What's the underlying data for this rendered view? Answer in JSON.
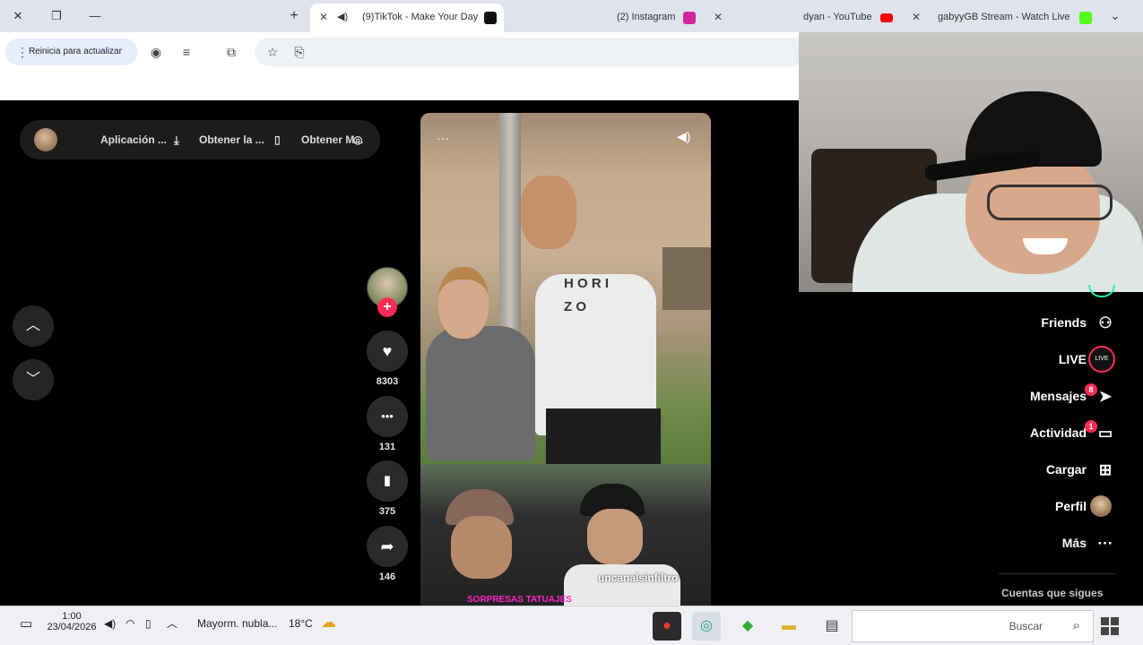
{
  "browser": {
    "tabs": [
      {
        "title": "gabyyGB Stream - Watch Live",
        "favicon": "kick-icon",
        "color": "#53fc18"
      },
      {
        "title": "dyan - YouTube",
        "favicon": "youtube-icon",
        "color": "#ff0000"
      },
      {
        "title": "(2) Instagram",
        "favicon": "instagram-icon",
        "color": "#d6249f"
      },
      {
        "title": "(9)TikTok - Make Your Day",
        "favicon": "tiktok-icon",
        "color": "#111111",
        "active": true
      }
    ],
    "new_tab": "+",
    "update_label": "Reinicia para actualizar"
  },
  "tiktok": {
    "top_bar_items": [
      "Obtener M...",
      "Obtener la ...",
      "Aplicación ..."
    ],
    "actions": [
      {
        "icon": "heart-icon",
        "glyph": "♥",
        "count": "8303"
      },
      {
        "icon": "comment-icon",
        "glyph": "•••",
        "count": "131"
      },
      {
        "icon": "bookmark-icon",
        "glyph": "▮",
        "count": "375"
      },
      {
        "icon": "share-icon",
        "glyph": "➦",
        "count": "146"
      }
    ],
    "follow": "+",
    "shirt_letters": "H O R I Z O",
    "caption": "uncanalsinfiltro",
    "caption_small": "SORPRESAS TATUAJES",
    "nav": [
      {
        "label": "Friends",
        "icon": "friends-icon",
        "glyph": "👥"
      },
      {
        "label": "LIVE",
        "icon": "live-icon",
        "glyph": "LIVE"
      },
      {
        "label": "Mensajes",
        "icon": "messages-icon",
        "glyph": "➤",
        "badge": "8"
      },
      {
        "label": "Actividad",
        "icon": "activity-icon",
        "glyph": "▭",
        "badge": "1"
      },
      {
        "label": "Cargar",
        "icon": "upload-icon",
        "glyph": "⊞"
      },
      {
        "label": "Perfil",
        "icon": "profile-icon",
        "glyph": ""
      },
      {
        "label": "Más",
        "icon": "more-icon",
        "glyph": "···"
      }
    ],
    "following_heading": "Cuentas que sigues"
  },
  "taskbar": {
    "search_placeholder": "Buscar",
    "weather_temp": "18°C",
    "weather_text": "Mayorm. nubla...",
    "time": "1:00",
    "date": "23/04/2026"
  }
}
